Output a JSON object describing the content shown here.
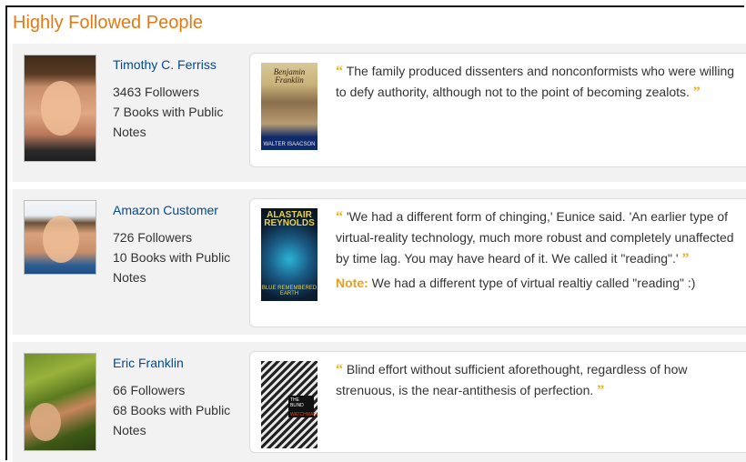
{
  "section": {
    "title": "Highly Followed People"
  },
  "people": [
    {
      "name": "Timothy C. Ferriss",
      "followers": "3463 Followers",
      "books": "7 Books with Public Notes",
      "book": {
        "title_art": "Benjamin Franklin",
        "author_art": "WALTER ISAACSON"
      },
      "quote": "The family produced dissenters and nonconformists who were willing to defy authority, although not to the point of becoming zealots."
    },
    {
      "name": "Amazon Customer",
      "followers": "726 Followers",
      "books": "10 Books with Public Notes",
      "book": {
        "title_art": "ALASTAIR REYNOLDS",
        "author_art": "BLUE REMEMBERED EARTH"
      },
      "quote": "'We had a different form of chinging,' Eunice said. 'An earlier type of virtual-reality technology, much more robust and completely unaffected by time lag. You may have heard of it. We called it \"reading\".'",
      "note_label": "Note:",
      "note": "We had a different type of virtual realtiy called \"reading\" :)"
    },
    {
      "name": "Eric Franklin",
      "followers": "66 Followers",
      "books": "68 Books with Public Notes",
      "book": {
        "title_art": "THE BLIND",
        "author_art": "WATCHMAKER"
      },
      "quote": "Blind effort without sufficient aforethought, regardless of how strenuous, is the near-antithesis of perfection."
    }
  ],
  "icons": {
    "quote_open": "left-quote-icon",
    "quote_close": "right-quote-icon"
  },
  "colors": {
    "heading": "#e47911",
    "link": "#004b91",
    "quote_mark": "#e8b12a",
    "note_label": "#e8a01a"
  }
}
